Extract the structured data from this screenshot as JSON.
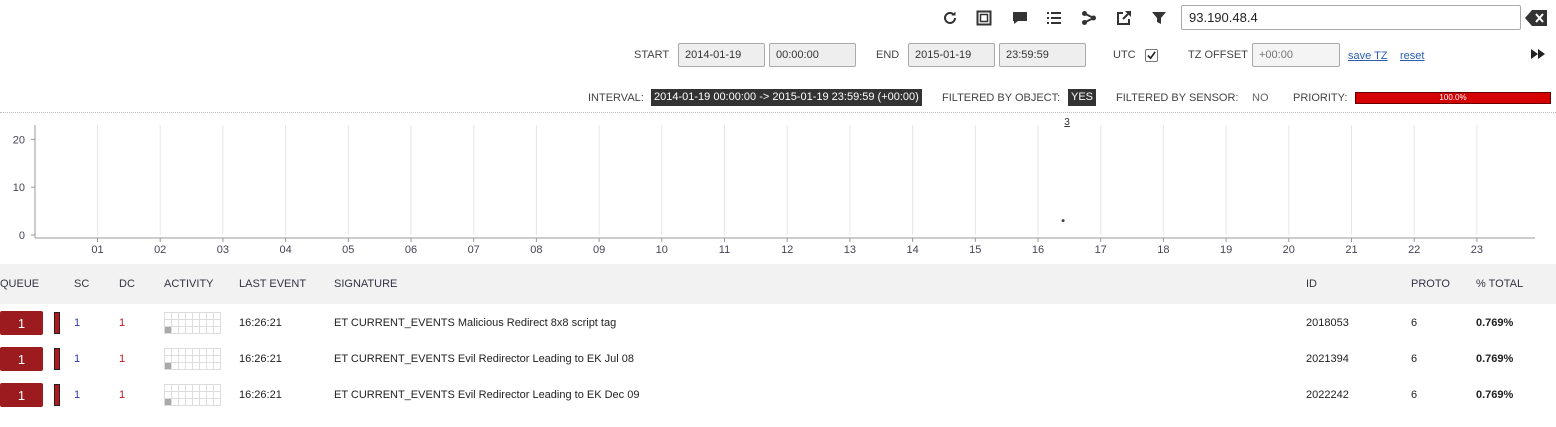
{
  "toolbar": {
    "icons": [
      "refresh-icon",
      "expand-icon",
      "comment-icon",
      "list-icon",
      "share-icon",
      "external-link-icon",
      "filter-icon"
    ],
    "search_value": "93.190.48.4"
  },
  "time": {
    "start_label": "START",
    "start_date": "2014-01-19",
    "start_time": "00:00:00",
    "end_label": "END",
    "end_date": "2015-01-19",
    "end_time": "23:59:59",
    "utc_label": "UTC",
    "utc_checked": true,
    "tz_label": "TZ OFFSET",
    "tz_placeholder": "+00:00",
    "save_tz": "save TZ",
    "reset": "reset"
  },
  "status": {
    "interval_label": "INTERVAL:",
    "interval_value": "2014-01-19 00:00:00 -> 2015-01-19 23:59:59 (+00:00)",
    "filtered_object_label": "FILTERED BY OBJECT:",
    "filtered_object_value": "YES",
    "filtered_sensor_label": "FILTERED BY SENSOR:",
    "filtered_sensor_value": "NO",
    "priority_label": "PRIORITY:",
    "priority_value": "100.0%"
  },
  "chart_data": {
    "type": "scatter",
    "categories": [
      "01",
      "02",
      "03",
      "04",
      "05",
      "06",
      "07",
      "08",
      "09",
      "10",
      "11",
      "12",
      "13",
      "14",
      "15",
      "16",
      "17",
      "18",
      "19",
      "20",
      "21",
      "22",
      "23"
    ],
    "yticks": [
      0,
      10,
      20
    ],
    "ylim": [
      0,
      23
    ],
    "points": [
      {
        "x": 16.4,
        "y": 3,
        "label": "3"
      }
    ]
  },
  "table": {
    "headers": {
      "queue": "QUEUE",
      "sc": "SC",
      "dc": "DC",
      "activity": "ACTIVITY",
      "last_event": "LAST EVENT",
      "signature": "SIGNATURE",
      "id": "ID",
      "proto": "PROTO",
      "total": "% TOTAL"
    },
    "rows": [
      {
        "queue": "1",
        "sc": "1",
        "dc": "1",
        "last_event": "16:26:21",
        "signature": "ET CURRENT_EVENTS Malicious Redirect 8x8 script tag",
        "id": "2018053",
        "proto": "6",
        "total": "0.769%"
      },
      {
        "queue": "1",
        "sc": "1",
        "dc": "1",
        "last_event": "16:26:21",
        "signature": "ET CURRENT_EVENTS Evil Redirector Leading to EK Jul 08",
        "id": "2021394",
        "proto": "6",
        "total": "0.769%"
      },
      {
        "queue": "1",
        "sc": "1",
        "dc": "1",
        "last_event": "16:26:21",
        "signature": "ET CURRENT_EVENTS Evil Redirector Leading to EK Dec 09",
        "id": "2022242",
        "proto": "6",
        "total": "0.769%"
      }
    ]
  }
}
